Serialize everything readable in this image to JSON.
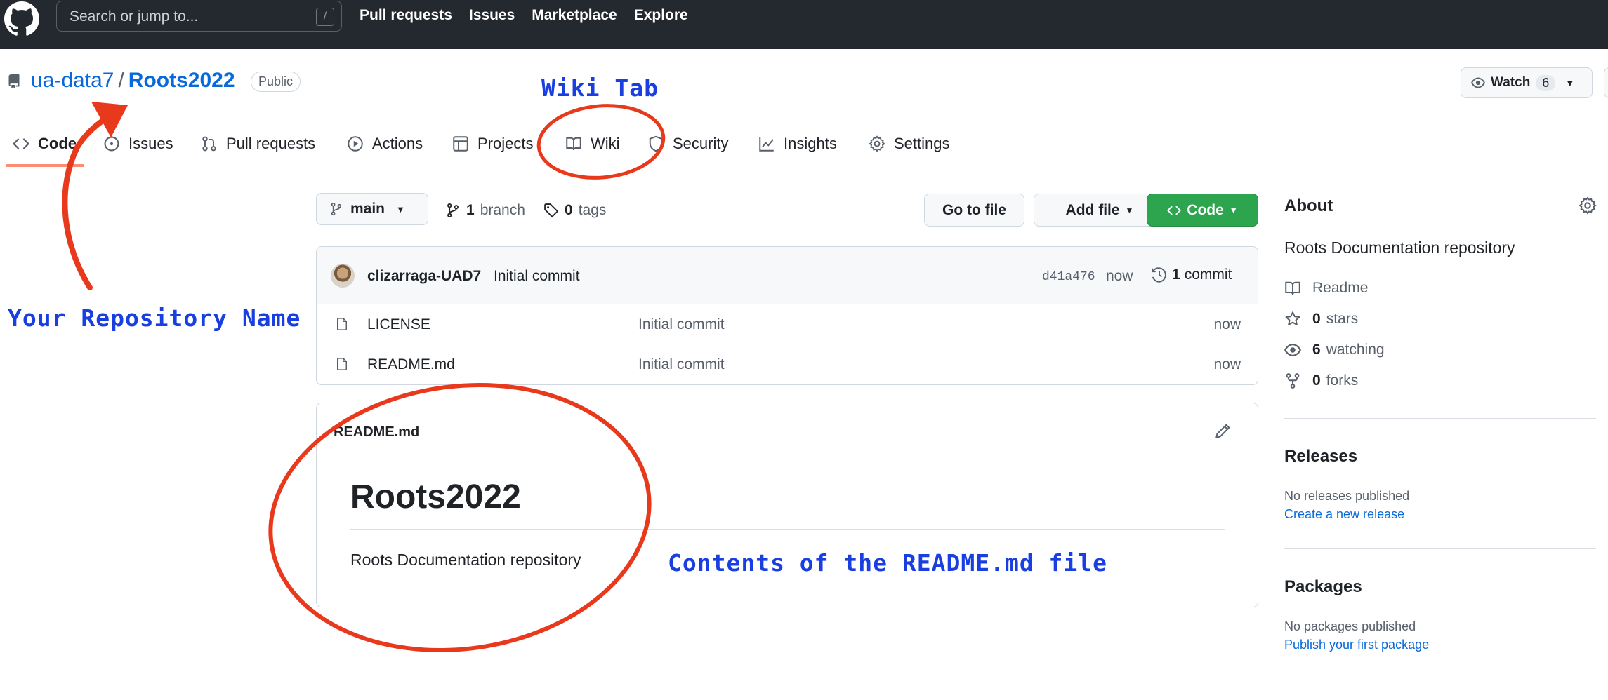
{
  "header": {
    "search_placeholder": "Search or jump to...",
    "search_shortcut": "/",
    "nav": [
      "Pull requests",
      "Issues",
      "Marketplace",
      "Explore"
    ]
  },
  "repo": {
    "owner": "ua-data7",
    "separator": "/",
    "name": "Roots2022",
    "visibility": "Public",
    "watch_label": "Watch",
    "watch_count": "6"
  },
  "tabs": [
    {
      "label": "Code",
      "icon": "code-icon"
    },
    {
      "label": "Issues",
      "icon": "issue-icon"
    },
    {
      "label": "Pull requests",
      "icon": "pull-request-icon"
    },
    {
      "label": "Actions",
      "icon": "play-icon"
    },
    {
      "label": "Projects",
      "icon": "table-icon"
    },
    {
      "label": "Wiki",
      "icon": "book-icon"
    },
    {
      "label": "Security",
      "icon": "shield-icon"
    },
    {
      "label": "Insights",
      "icon": "graph-icon"
    },
    {
      "label": "Settings",
      "icon": "gear-icon"
    }
  ],
  "branch_bar": {
    "branch": "main",
    "branch_count": "1",
    "branch_label": "branch",
    "tag_count": "0",
    "tag_label": "tags",
    "goto_file": "Go to file",
    "add_file": "Add file",
    "code_button": "Code"
  },
  "latest_commit": {
    "author": "clizarraga-UAD7",
    "message": "Initial commit",
    "sha": "d41a476",
    "time": "now",
    "count": "1",
    "count_label": "commit"
  },
  "files": [
    {
      "name": "LICENSE",
      "message": "Initial commit",
      "time": "now"
    },
    {
      "name": "README.md",
      "message": "Initial commit",
      "time": "now"
    }
  ],
  "readme": {
    "filename": "README.md",
    "heading": "Roots2022",
    "body": "Roots Documentation repository"
  },
  "sidebar": {
    "about_title": "About",
    "description": "Roots Documentation repository",
    "readme_label": "Readme",
    "stars_count": "0",
    "stars_label": "stars",
    "watching_count": "6",
    "watching_label": "watching",
    "forks_count": "0",
    "forks_label": "forks",
    "releases_title": "Releases",
    "releases_none": "No releases published",
    "releases_link": "Create a new release",
    "packages_title": "Packages",
    "packages_none": "No packages published",
    "packages_link": "Publish your first package"
  },
  "annotations": {
    "wiki_tab": "Wiki Tab",
    "repo_name": "Your Repository Name",
    "readme_contents": "Contents of the README.md file"
  },
  "colors": {
    "header_bg": "#24292f",
    "link": "#0969da",
    "code_button": "#2da44e",
    "annotation_red": "#e8391d",
    "annotation_blue": "#1a3fe0"
  }
}
